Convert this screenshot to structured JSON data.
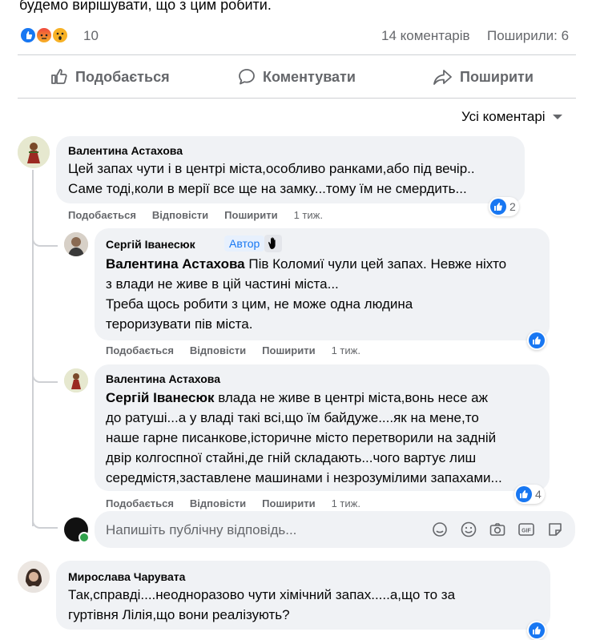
{
  "post": {
    "text_tail": "будемо вирішувати, що з цим робити.",
    "reactions_count": "10",
    "comments_count": "14 коментарів",
    "shares_count": "Поширили: 6"
  },
  "actions": {
    "like": "Подобається",
    "comment": "Коментувати",
    "share": "Поширити"
  },
  "sort": {
    "label": "Усі коментарі"
  },
  "comments": [
    {
      "author": "Валентина Астахова",
      "line1": "Цей запах чути і в центрі міста,особливо ранками,або під вечір..",
      "line2": "Саме тоді,коли в мерії все ще на замку...тому їм не смердить...",
      "like": "Подобається",
      "reply": "Відповісти",
      "share": "Поширити",
      "time": "1 тиж.",
      "reactions": "2"
    },
    {
      "author": "Сергій Іванесюк",
      "badge": "Автор",
      "mention": "Валентина Астахова",
      "line1_rest": " Пів Коломиї чули цей запах. Невже ніхто",
      "line2": "з влади не живе в цій частині міста...",
      "line3": "Треба щось робити з цим, не може одна людина",
      "line4": "тероризувати пів міста.",
      "like": "Подобається",
      "reply": "Відповісти",
      "share": "Поширити",
      "time": "1 тиж."
    },
    {
      "author": "Валентина Астахова",
      "mention": "Сергій Іванесюк",
      "line1_rest": " влада не живе в центрі міста,вонь несе аж",
      "line2": "до ратуші...а у владі такі всі,що їм байдуже....як на мене,то",
      "line3": "наше гарне писанкове,історичне місто перетворили на задній",
      "line4": "двір колгоспної стайні,де гній складають...чого вартує лиш",
      "line5": "середмістя,заставлене машинами і незрозумілими запахами...",
      "like": "Подобається",
      "reply": "Відповісти",
      "share": "Поширити",
      "time": "1 тиж.",
      "reactions": "4"
    },
    {
      "author": "Мирослава Чарувата",
      "line1": "Так,справді....неодноразово чути хімічний запах.....а,що то за",
      "line2": "гуртівня Лілія,що вони реалізують?"
    }
  ],
  "reply": {
    "placeholder": "Напишіть публічну відповідь..."
  },
  "colors": {
    "accent": "#1877f2",
    "bubble": "#f0f2f5",
    "muted": "#65676b"
  }
}
